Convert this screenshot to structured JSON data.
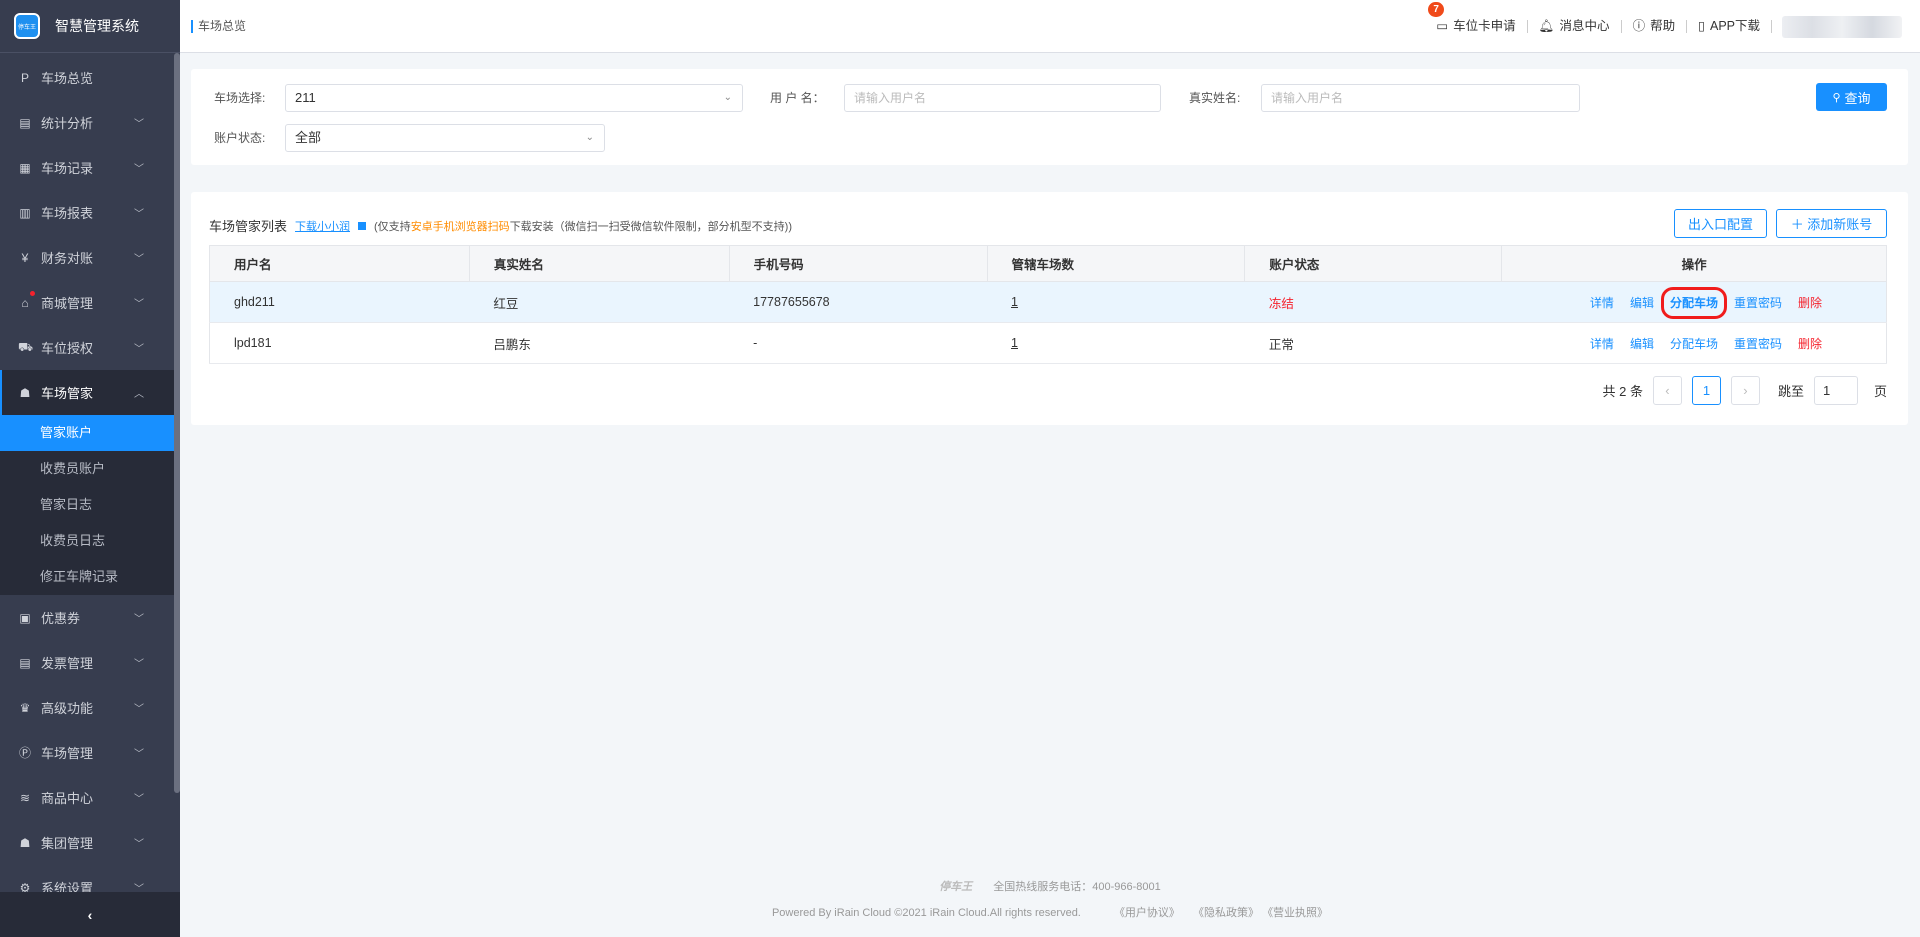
{
  "app": {
    "logo_text": "停车王",
    "title": "智慧管理系统"
  },
  "breadcrumb": "车场总览",
  "header": {
    "card_apply": "车位卡申请",
    "card_badge": "7",
    "messages": "消息中心",
    "help": "帮助",
    "app_download": "APP下载"
  },
  "sidebar": {
    "items_top": [
      {
        "icon": "P",
        "label": "车场总览"
      },
      {
        "icon": "▤",
        "label": "统计分析"
      },
      {
        "icon": "▦",
        "label": "车场记录"
      },
      {
        "icon": "▥",
        "label": "车场报表"
      },
      {
        "icon": "¥",
        "label": "财务对账"
      },
      {
        "icon": "⌂",
        "label": "商城管理"
      },
      {
        "icon": "⛟",
        "label": "车位授权"
      }
    ],
    "open": {
      "icon": "☗",
      "label": "车场管家",
      "children": [
        "管家账户",
        "收费员账户",
        "管家日志",
        "收费员日志",
        "修正车牌记录"
      ]
    },
    "items_bottom": [
      {
        "icon": "▣",
        "label": "优惠券"
      },
      {
        "icon": "▤",
        "label": "发票管理"
      },
      {
        "icon": "♛",
        "label": "高级功能"
      },
      {
        "icon": "Ⓟ",
        "label": "车场管理"
      },
      {
        "icon": "≋",
        "label": "商品中心"
      },
      {
        "icon": "☗",
        "label": "集团管理"
      },
      {
        "icon": "⚙",
        "label": "系统设置"
      }
    ],
    "collapse": "‹"
  },
  "filters": {
    "lot_label": "车场选择:",
    "lot_value": "211",
    "username_label": "用 户 名：",
    "username_placeholder": "请输入用户名",
    "realname_label": "真实姓名:",
    "realname_placeholder": "请输入用户名",
    "status_label": "账户状态:",
    "status_value": "全部",
    "search": "查询"
  },
  "list": {
    "title": "车场管家列表",
    "download_link": "下载小小润",
    "note_prefix": "(仅支持",
    "note_highlight": "安卓手机浏览器扫码",
    "note_suffix": "下载安装（微信扫一扫受微信软件限制，部分机型不支持))",
    "btn_gate": "出入口配置",
    "btn_add": "＋ 添加新账号",
    "columns": [
      "用户名",
      "真实姓名",
      "手机号码",
      "管辖车场数",
      "账户状态",
      "操作"
    ],
    "rows": [
      {
        "username": "ghd211",
        "realname": "红豆",
        "phone": "17787655678",
        "lots": "1",
        "status": "冻结"
      },
      {
        "username": "lpd181",
        "realname": "吕鹏东",
        "phone": "-",
        "lots": "1",
        "status": "正常"
      }
    ],
    "ops": [
      "详情",
      "编辑",
      "分配车场",
      "重置密码",
      "删除"
    ]
  },
  "pagination": {
    "total": "共 2 条",
    "page": "1",
    "jump_label": "跳至",
    "jump_value": "1",
    "page_unit": "页"
  },
  "footer": {
    "brand": "停车王",
    "hotline": "全国热线服务电话：400-966-8001",
    "copyright": "Powered By iRain Cloud ©2021 iRain Cloud.All rights reserved.",
    "links": [
      "《用户协议》",
      "《隐私政策》",
      "《营业执照》"
    ]
  }
}
